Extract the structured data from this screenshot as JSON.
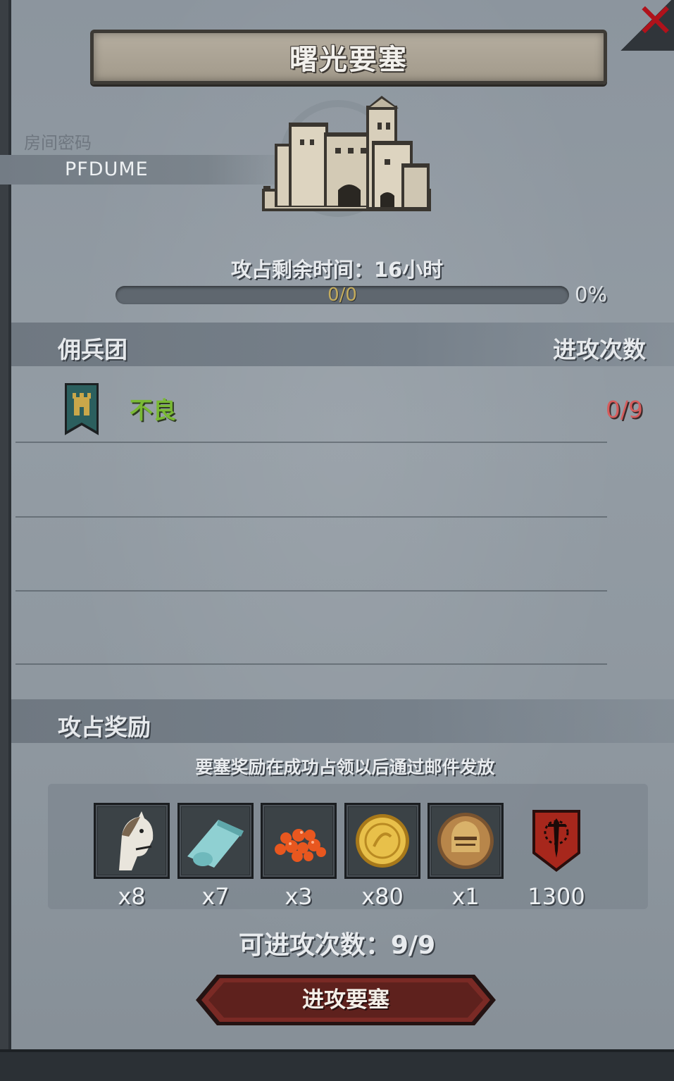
{
  "dialog": {
    "title": "曙光要塞",
    "close_glyph": "✕"
  },
  "room": {
    "label": "房间密码",
    "code": "PFDUME"
  },
  "capture": {
    "remaining_time_text": "攻占剩余时间：16小时",
    "progress_text": "0/0",
    "progress_percent_text": "0%",
    "progress_fraction": 0
  },
  "mercenary": {
    "section_title": "佣兵团",
    "attack_count_header": "进攻次数",
    "rows": [
      {
        "name": "不良",
        "count": "0/9",
        "emblem_icon": "tower-banner-icon"
      }
    ]
  },
  "rewards": {
    "section_title": "攻占奖励",
    "note": "要塞奖励在成功占领以后通过邮件发放",
    "items": [
      {
        "icon": "horse-icon",
        "qty": "x8"
      },
      {
        "icon": "cloth-roll-icon",
        "qty": "x7"
      },
      {
        "icon": "red-gems-icon",
        "qty": "x3"
      },
      {
        "icon": "gold-coin-icon",
        "qty": "x80"
      },
      {
        "icon": "knight-helmet-medal-icon",
        "qty": "x1"
      },
      {
        "icon": "sword-banner-icon",
        "qty": "1300"
      }
    ]
  },
  "attacks": {
    "available_text": "可进攻次数：9/9"
  },
  "actions": {
    "attack_button": "进攻要塞"
  },
  "colors": {
    "merc_name": "#79b934",
    "merc_count": "#d65c5c",
    "close": "#b0121b",
    "button": "#6e2a26"
  }
}
